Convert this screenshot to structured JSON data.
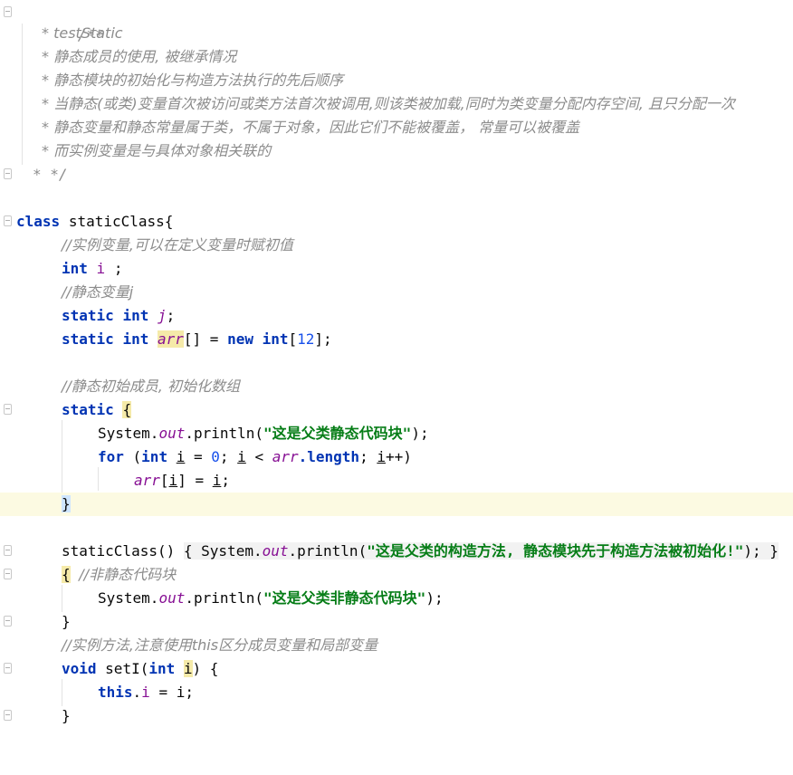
{
  "doc_comment": {
    "open": "/**",
    "lines": [
      "* testStatic",
      "* 静态成员的使用, 被继承情况",
      "* 静态模块的初始化与构造方法执行的先后顺序",
      "* 当静态(或类)变量首次被访问或类方法首次被调用,则该类被加载,同时为类变量分配内存空间, 且只分配一次",
      "* 静态变量和静态常量属于类，不属于对象，因此它们不能被覆盖， 常量可以被覆盖",
      "* 而实例变量是与具体对象相关联的"
    ],
    "close": "* */"
  },
  "code": {
    "class_kw": "class",
    "class_name": "staticClass{",
    "c_instance": "//实例变量,可以在定义变量时赋初值",
    "int_kw": "int",
    "var_i": "i",
    "semi": ";",
    "c_static_j": "//静态变量j",
    "static_kw": "static",
    "var_j": "j",
    "var_arr": "arr",
    "arr_decl_rest": "[] = ",
    "new_kw": "new",
    "arr_size_open": "[",
    "arr_size": "12",
    "arr_size_close": "];",
    "c_static_init": "//静态初始成员, 初始化数组",
    "open_brace": "{",
    "close_brace": "}",
    "system": "System.",
    "out": "out",
    "println": ".println(",
    "str_static_block": "\"这是父类静态代码块\"",
    "call_end": ");",
    "for_kw": "for",
    "for_open": " (",
    "eq_zero": " = ",
    "zero": "0",
    "for_mid": "; ",
    "lt": " < ",
    "length_kw": ".length",
    "inc": "++)",
    "arr_idx_open": "[",
    "arr_assign": "] = ",
    "constructor": "staticClass()",
    "str_constructor": "\"这是父类的构造方法, 静态模块先于构造方法被初始化!\"",
    "c_nonstatic": "//非静态代码块",
    "str_nonstatic": "\"这是父类非静态代码块\"",
    "c_method": "//实例方法,注意使用this区分成员变量和局部变量",
    "void_kw": "void",
    "set_name": "setI(",
    "param_close": ") {",
    "this_kw": "this",
    "dot": ".",
    "assign": " = "
  }
}
